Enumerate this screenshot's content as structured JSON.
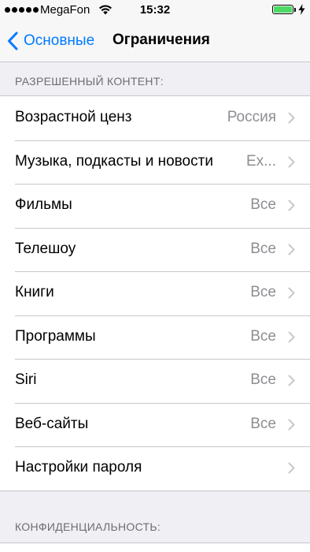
{
  "status_bar": {
    "carrier": "MegaFon",
    "time": "15:32",
    "battery_level": 1.0,
    "battery_color": "#4cd964"
  },
  "nav": {
    "back_label": "Основные",
    "title": "Ограничения",
    "accent_color": "#007aff"
  },
  "sections": {
    "content_header": "РАЗРЕШЕННЫЙ КОНТЕНТ:",
    "privacy_header": "КОНФИДЕНЦИАЛЬНОСТЬ:"
  },
  "rows": [
    {
      "label": "Возрастной ценз",
      "value": "Россия"
    },
    {
      "label": "Музыка, подкасты и новости",
      "value": "Ex..."
    },
    {
      "label": "Фильмы",
      "value": "Все"
    },
    {
      "label": "Телешоу",
      "value": "Все"
    },
    {
      "label": "Книги",
      "value": "Все"
    },
    {
      "label": "Программы",
      "value": "Все"
    },
    {
      "label": "Siri",
      "value": "Все"
    },
    {
      "label": "Веб-сайты",
      "value": "Все"
    },
    {
      "label": "Настройки пароля",
      "value": ""
    }
  ],
  "icons": {
    "back": "chevron-left-icon",
    "disclosure": "chevron-right-icon",
    "wifi": "wifi-icon",
    "charging": "lightning-icon"
  }
}
